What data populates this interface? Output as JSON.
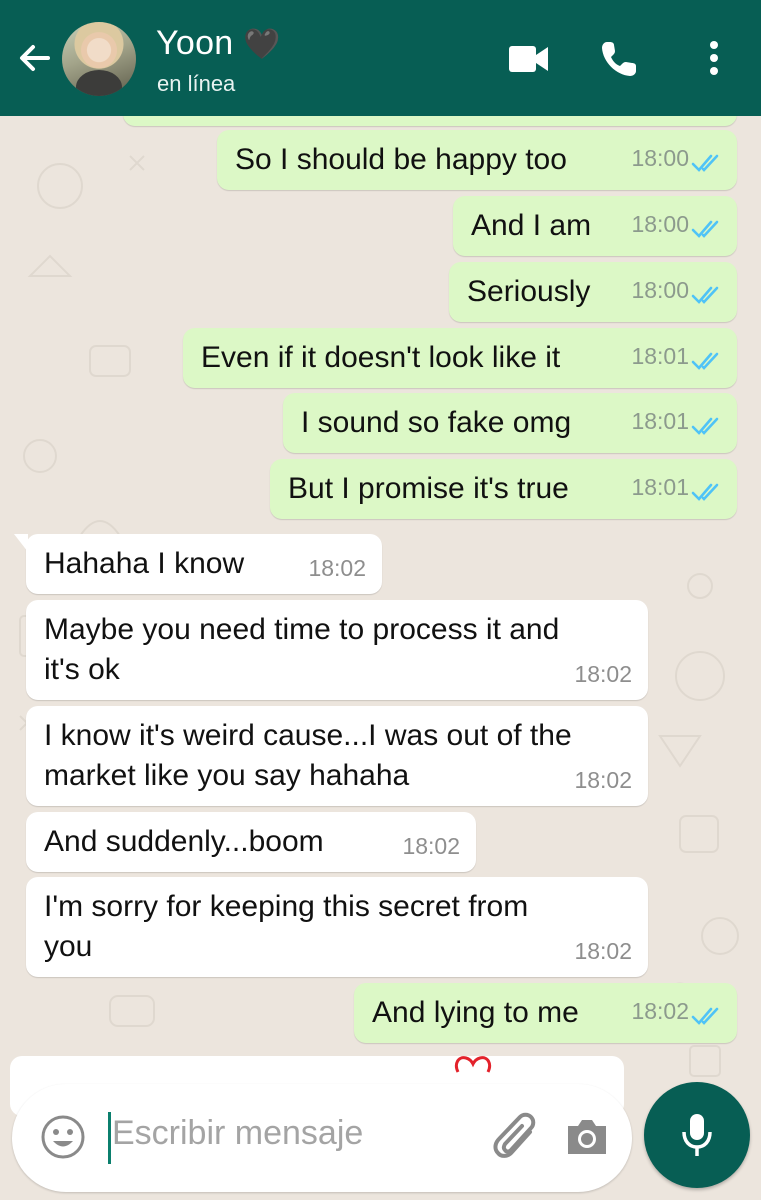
{
  "header": {
    "contact_name": "Yoon",
    "name_emoji": "🖤",
    "status": "en línea",
    "color": "#075e54"
  },
  "icons": {
    "back": "arrow-left-icon",
    "video": "video-camera-icon",
    "call": "phone-icon",
    "menu": "more-vertical-icon",
    "emoji": "emoji-icon",
    "attach": "paperclip-icon",
    "camera": "camera-icon",
    "mic": "microphone-icon",
    "read": "double-check-icon"
  },
  "colors": {
    "outgoing_bubble": "#dcf8c6",
    "incoming_bubble": "#ffffff",
    "read_ticks": "#4fc3f7",
    "chat_background": "#ece5dd"
  },
  "messages": [
    {
      "direction": "out",
      "text": "So I should be happy too",
      "time": "18:00",
      "status": "read"
    },
    {
      "direction": "out",
      "text": "And I am",
      "time": "18:00",
      "status": "read"
    },
    {
      "direction": "out",
      "text": "Seriously",
      "time": "18:00",
      "status": "read"
    },
    {
      "direction": "out",
      "text": "Even if it doesn't look like it",
      "time": "18:01",
      "status": "read"
    },
    {
      "direction": "out",
      "text": "I sound so fake omg",
      "time": "18:01",
      "status": "read"
    },
    {
      "direction": "out",
      "text": "But I promise it's true",
      "time": "18:01",
      "status": "read"
    },
    {
      "direction": "in",
      "text": "Hahaha I know",
      "time": "18:02"
    },
    {
      "direction": "in",
      "text": "Maybe you need time to process it and\nit's ok",
      "time": "18:02"
    },
    {
      "direction": "in",
      "text": "I know it's weird cause...I was out of the\nmarket like you say hahaha",
      "time": "18:02"
    },
    {
      "direction": "in",
      "text": "And suddenly...boom",
      "time": "18:02"
    },
    {
      "direction": "in",
      "text": "I'm sorry for keeping this secret from\nyou",
      "time": "18:02"
    },
    {
      "direction": "out",
      "text": "And lying to me",
      "time": "18:02",
      "status": "read"
    }
  ],
  "composer": {
    "placeholder": "Escribir mensaje"
  }
}
